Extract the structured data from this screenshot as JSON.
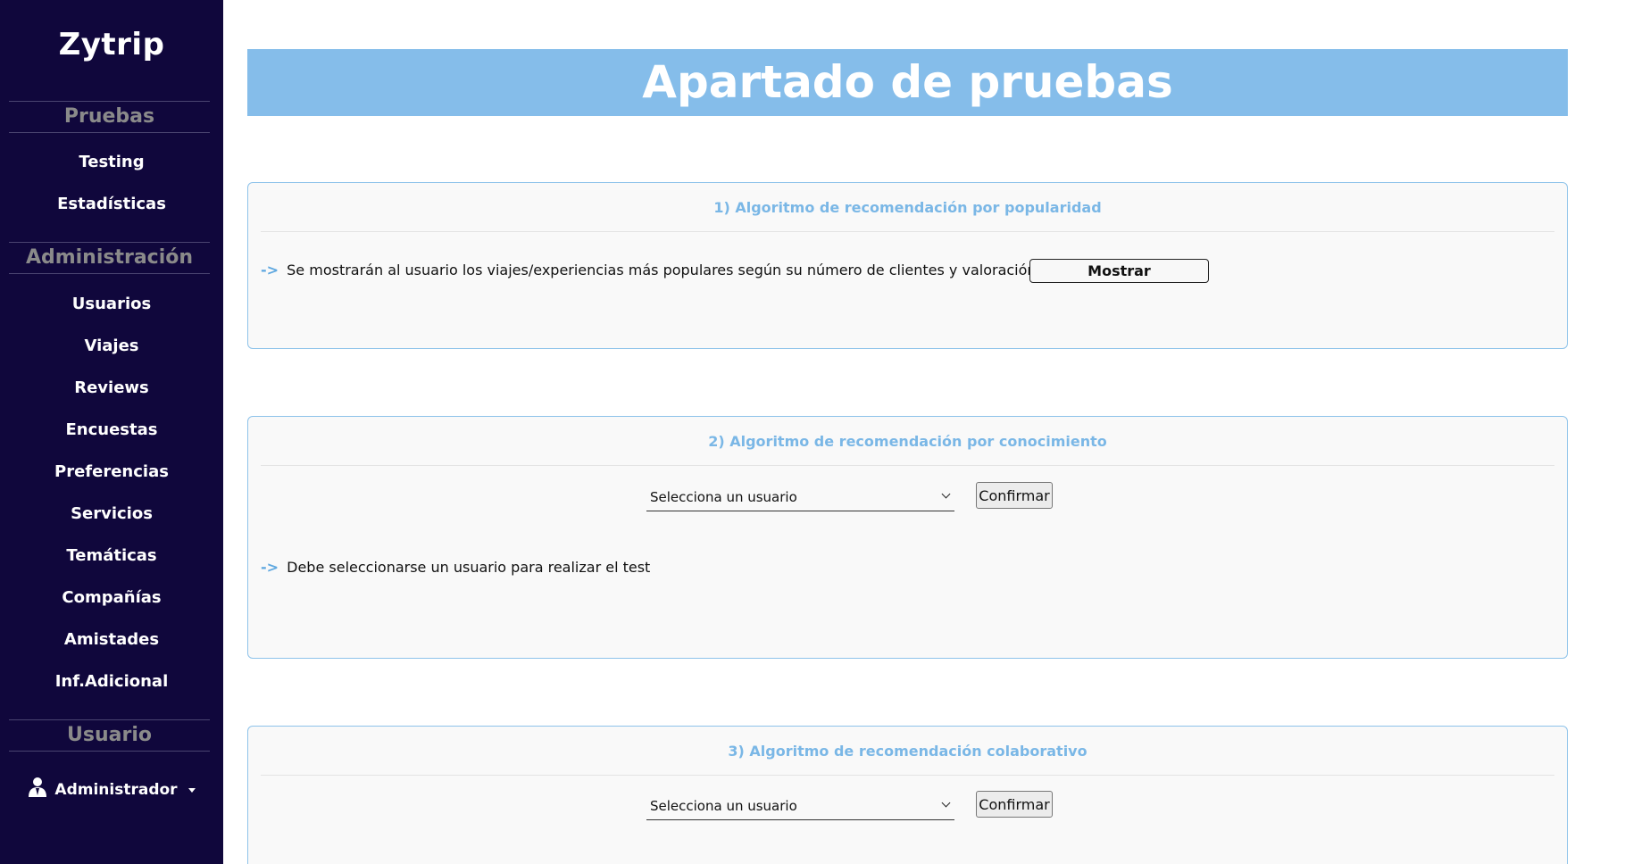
{
  "sidebar": {
    "brand": "Zytrip",
    "sections": {
      "pruebas": "Pruebas",
      "administracion": "Administración",
      "usuario": "Usuario"
    },
    "pruebas_items": [
      "Testing",
      "Estadísticas"
    ],
    "admin_items": [
      "Usuarios",
      "Viajes",
      "Reviews",
      "Encuestas",
      "Preferencias",
      "Servicios",
      "Temáticas",
      "Compañías",
      "Amistades",
      "Inf.Adicional"
    ],
    "user": {
      "label": "Administrador",
      "icon": "user-icon"
    }
  },
  "main": {
    "banner_title": "Apartado de pruebas",
    "card1": {
      "title": "1) Algoritmo de recomendación por popularidad",
      "arrow": "->",
      "text": "Se mostrarán al usuario los viajes/experiencias más populares según su número de clientes y valoración.",
      "button": "Mostrar"
    },
    "card2": {
      "title": "2) Algoritmo de recomendación por conocimiento",
      "select_value": "Selecciona un usuario",
      "button": "Confirmar",
      "arrow": "->",
      "message": "Debe seleccionarse un usuario para realizar el test"
    },
    "card3": {
      "title": "3) Algoritmo de recomendación colaborativo",
      "select_value": "Selecciona un usuario",
      "button": "Confirmar"
    }
  },
  "colors": {
    "sidebar_bg": "#10073c",
    "banner_bg": "#85bdea",
    "card_title": "#7ab7e6",
    "card_border": "#8ec3ea"
  }
}
